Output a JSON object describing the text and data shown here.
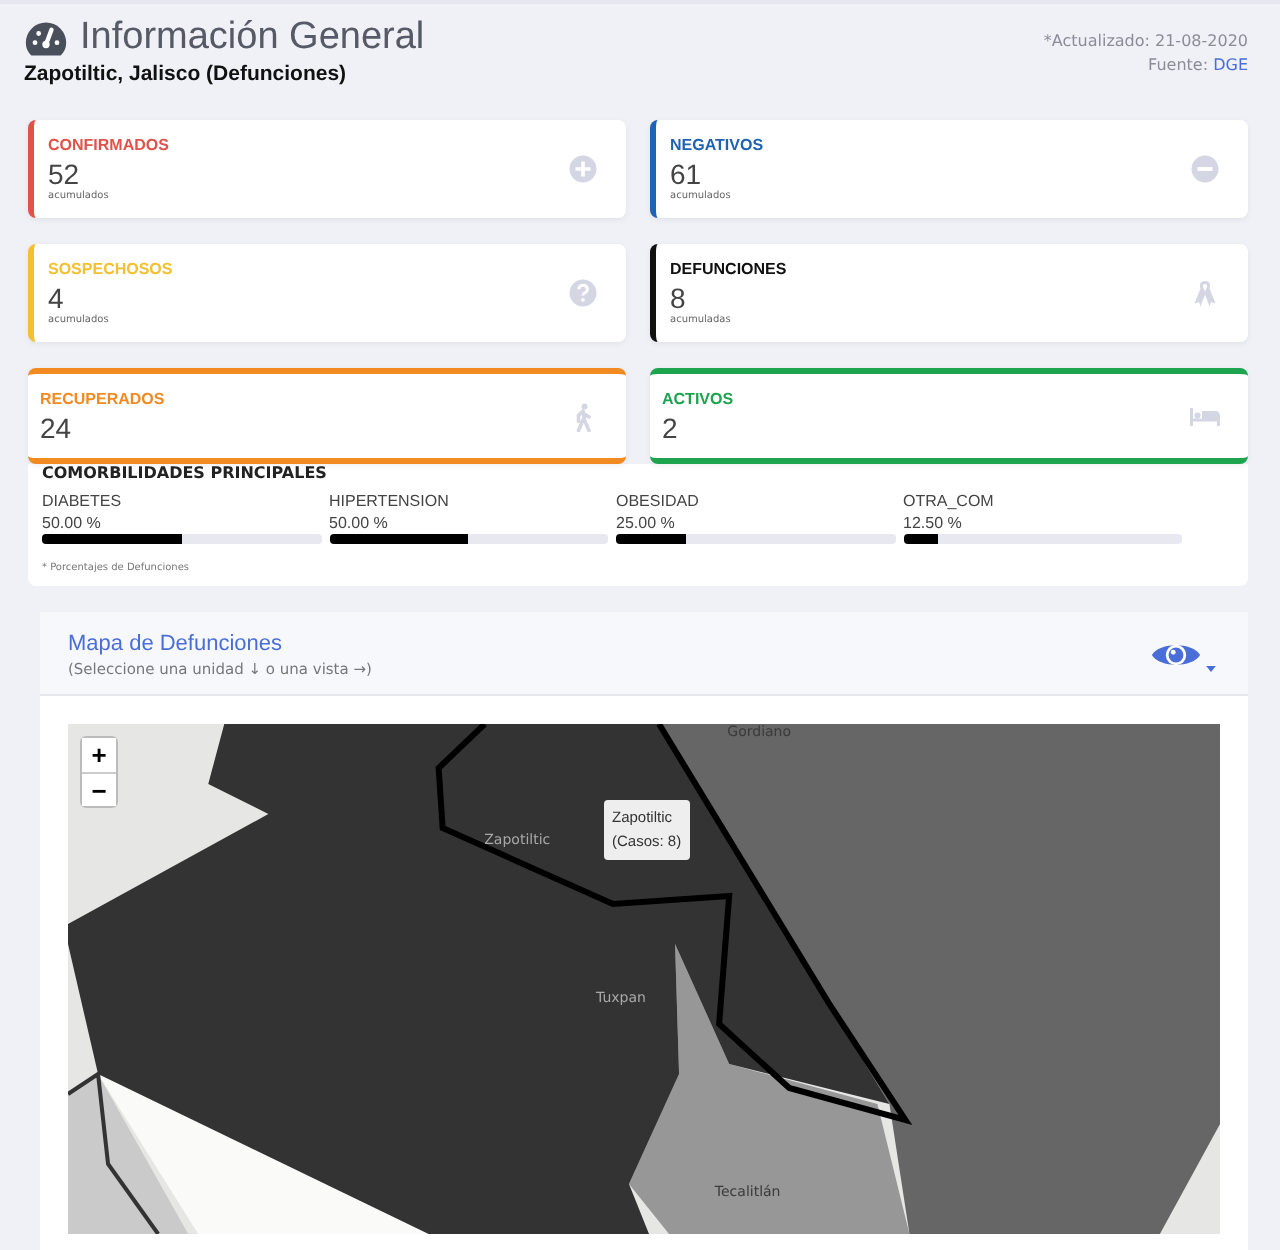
{
  "header": {
    "title": "Información General",
    "subtitle": "Zapotiltic, Jalisco (Defunciones)",
    "updated": "*Actualizado: 21-08-2020",
    "source_label": "Fuente:",
    "source_link": "DGE"
  },
  "cards": [
    {
      "label": "CONFIRMADOS",
      "value": "52",
      "note": "acumulados",
      "color": "#e0534a",
      "kind": "side"
    },
    {
      "label": "NEGATIVOS",
      "value": "61",
      "note": "acumulados",
      "color": "#1f63b5",
      "kind": "side"
    },
    {
      "label": "SOSPECHOSOS",
      "value": "4",
      "note": "acumulados",
      "color": "#f2c031",
      "kind": "side"
    },
    {
      "label": "DEFUNCIONES",
      "value": "8",
      "note": "acumuladas",
      "color": "#111111",
      "kind": "side"
    },
    {
      "label": "RECUPERADOS",
      "value": "24",
      "color": "#f28a22",
      "kind": "band"
    },
    {
      "label": "ACTIVOS",
      "value": "2",
      "color": "#1ea44f",
      "kind": "band"
    }
  ],
  "comorbidities": {
    "title": "COMORBILIDADES PRINCIPALES",
    "note": "* Porcentajes  de Defunciones",
    "items": [
      {
        "name": "DIABETES",
        "reading": "50.00 %",
        "level": 0.5
      },
      {
        "name": "HIPERTENSION",
        "reading": "50.00 %",
        "level": 0.5
      },
      {
        "name": "OBESIDAD",
        "reading": "25.00 %",
        "level": 0.25
      },
      {
        "name": "OTRA_COM",
        "reading": "12.50 %",
        "level": 0.125
      }
    ]
  },
  "map": {
    "title": "Mapa de Defunciones",
    "hint": "(Seleccione una unidad ↓ o una vista →)",
    "zoom_in": "+",
    "zoom_out": "−",
    "labels": [
      "Gordiano",
      "Zapotiltic",
      "Tuxpan",
      "Tecalitlán"
    ],
    "tooltip": {
      "name": "Zapotiltic",
      "count": "(Casos: 8)"
    }
  }
}
